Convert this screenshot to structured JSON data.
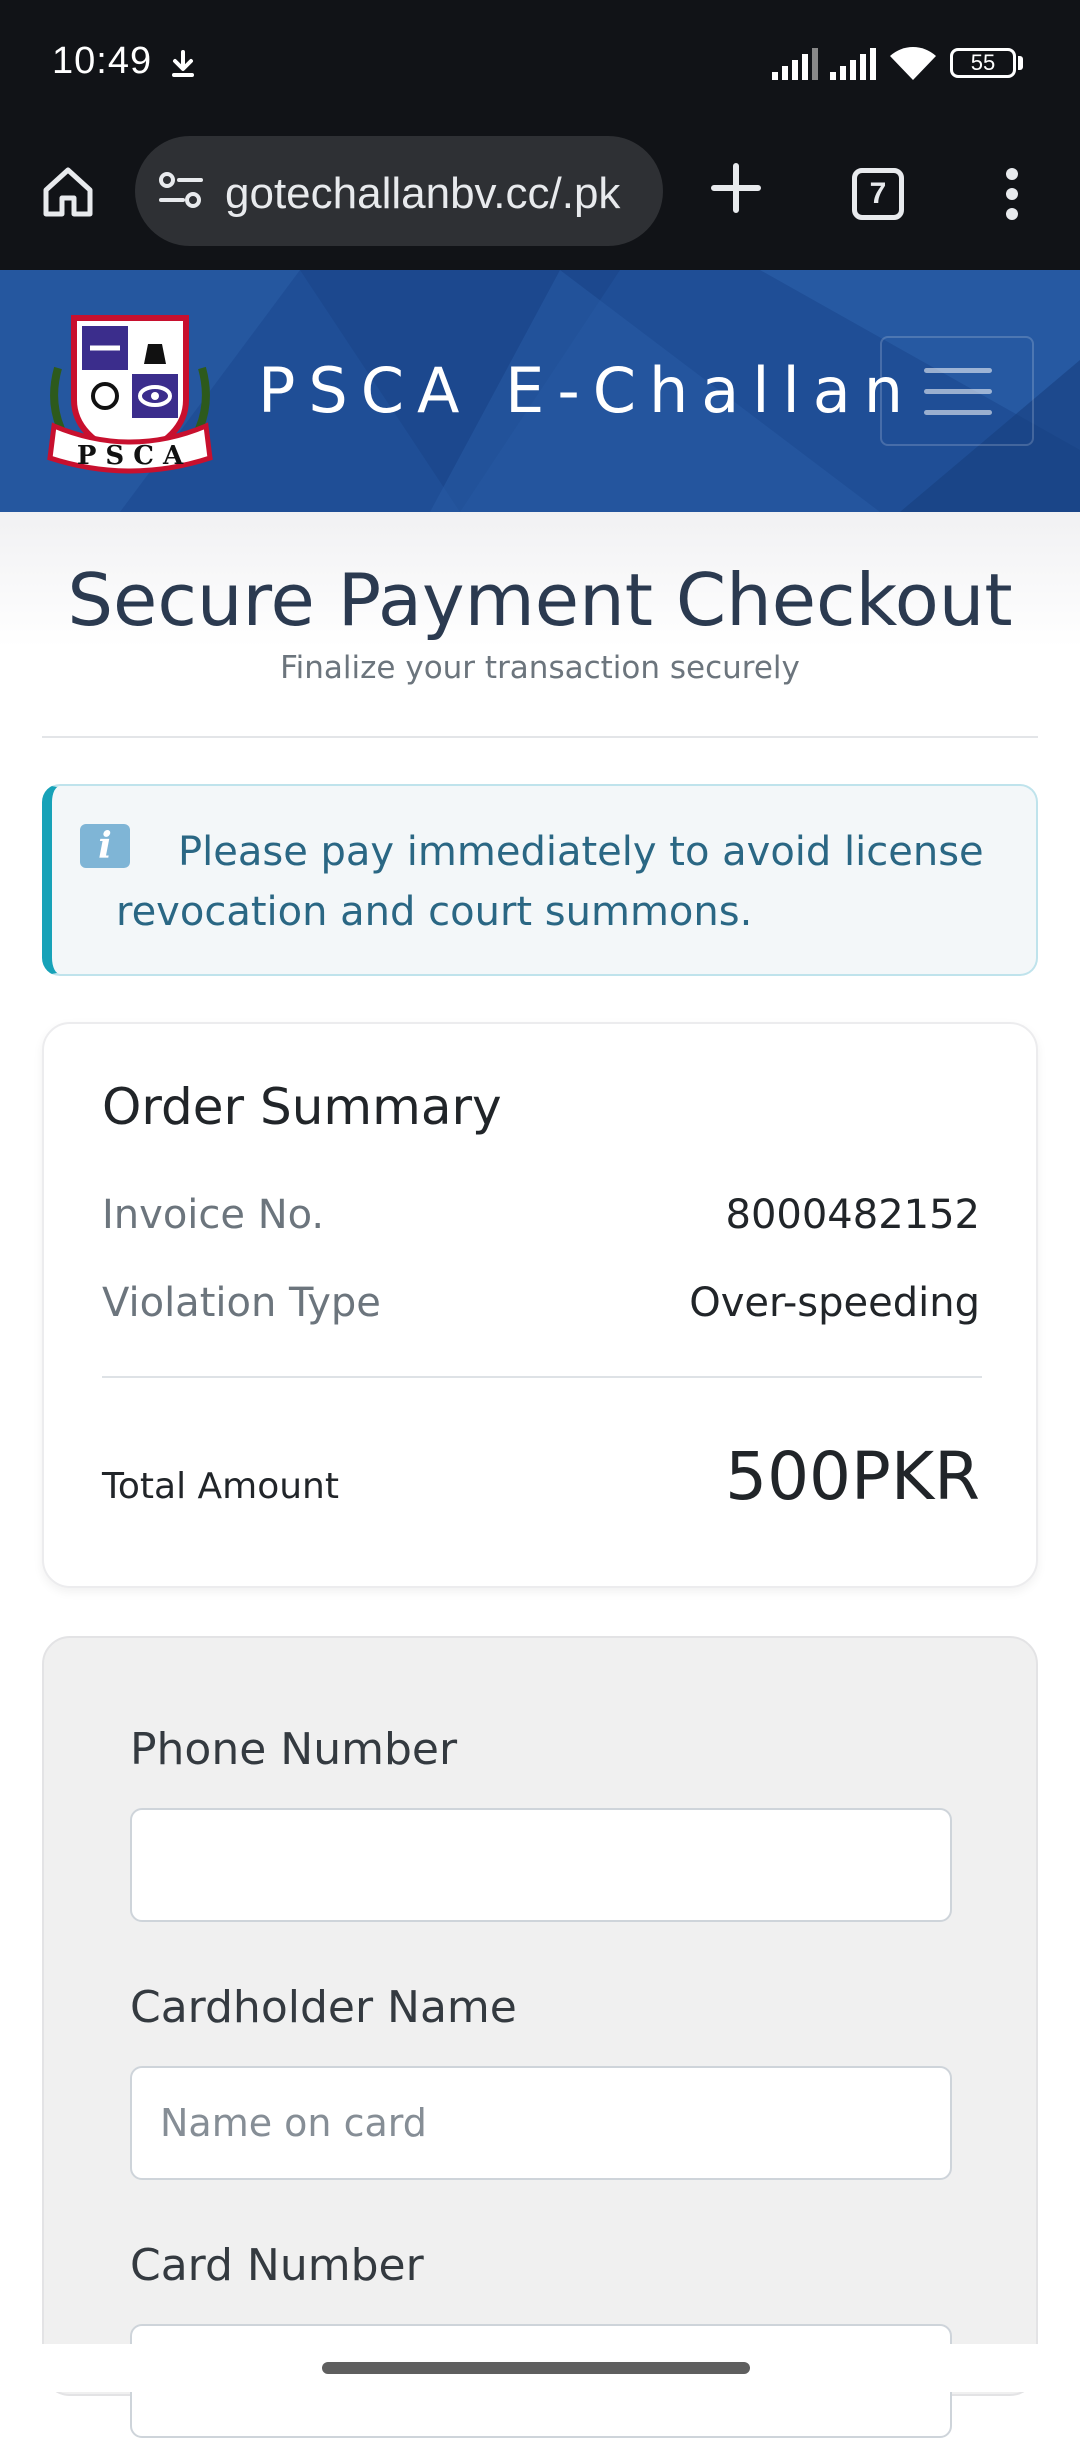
{
  "status_bar": {
    "time": "10:49",
    "battery": "55"
  },
  "browser": {
    "url": "gotechallanbv.cc/.pk",
    "tab_count": "7"
  },
  "site": {
    "title": "PSCA E-Challan",
    "logo_text": "P S C A"
  },
  "page": {
    "title": "Secure Payment Checkout",
    "subtitle": "Finalize your transaction securely"
  },
  "alert": {
    "icon": "i",
    "text": "Please pay immediately to avoid license revocation and court summons."
  },
  "order": {
    "title": "Order Summary",
    "rows": [
      {
        "label": "Invoice No.",
        "value": "8000482152"
      },
      {
        "label": "Violation Type",
        "value": "Over-speeding"
      }
    ],
    "total_label": "Total Amount",
    "total_value": "500PKR"
  },
  "form": {
    "phone_label": "Phone Number",
    "phone_value": "",
    "phone_placeholder": "",
    "cardholder_label": "Cardholder Name",
    "cardholder_placeholder": "Name on card",
    "card_number_label": "Card Number"
  },
  "colors": {
    "header_blue": "#1f4e96",
    "alert_accent": "#17a2b8",
    "browser_dark": "#111317"
  }
}
